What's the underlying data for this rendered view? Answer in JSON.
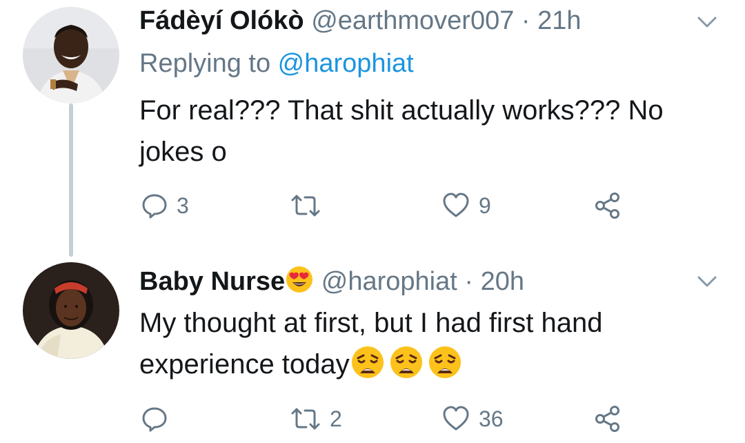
{
  "tweets": [
    {
      "name": "Fádèyí Olókò",
      "handle": "@earthmover007",
      "separator": "·",
      "time": "21h",
      "replying_prefix": "Replying to ",
      "replying_to": "@harophiat",
      "text_line1": "For real??? That shit actually works??? No",
      "text_line2": "jokes o",
      "reply_count": "3",
      "retweet_count": "",
      "like_count": "9"
    },
    {
      "name": "Baby Nurse",
      "name_emoji": "heart-eyes-emoji",
      "handle": "@harophiat",
      "separator": "·",
      "time": "20h",
      "text_line1": "My thought at first, but I had first hand",
      "text_line2": "experience today",
      "text_emojis": [
        "weary-face-emoji",
        "weary-face-emoji",
        "weary-face-emoji"
      ],
      "reply_count": "",
      "retweet_count": "2",
      "like_count": "36"
    }
  ],
  "colors": {
    "text": "#14171a",
    "muted": "#657786",
    "link": "#1b95e0",
    "thread_line": "#c4cfd6"
  }
}
